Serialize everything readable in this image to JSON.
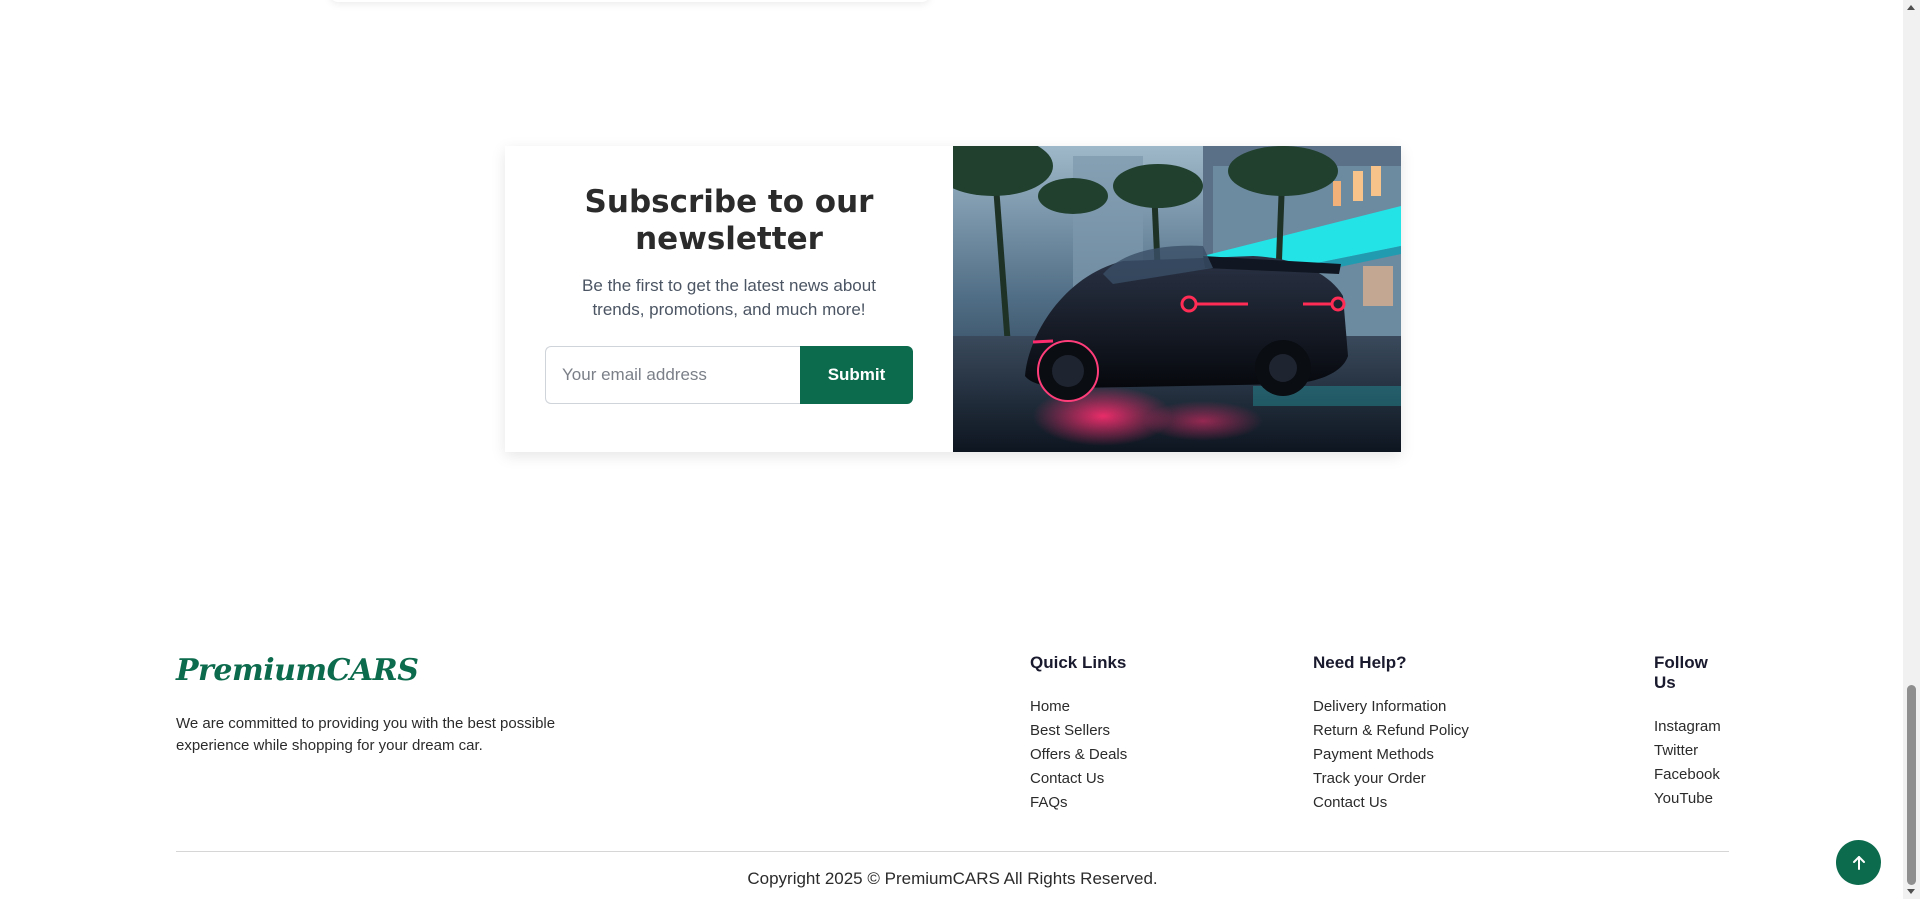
{
  "newsletter": {
    "title": "Subscribe to our newsletter",
    "subtitle": "Be the first to get the latest news about trends, promotions, and much more!",
    "email_placeholder": "Your email address",
    "submit_label": "Submit",
    "image": "sports-car-night-city-image"
  },
  "footer": {
    "brand": "PremiumCARS",
    "description": "We are committed to providing you with the best possible experience while shopping for your dream car.",
    "quick_links": {
      "title": "Quick Links",
      "items": [
        "Home",
        "Best Sellers",
        "Offers & Deals",
        "Contact Us",
        "FAQs"
      ]
    },
    "need_help": {
      "title": "Need Help?",
      "items": [
        "Delivery Information",
        "Return & Refund Policy",
        "Payment Methods",
        "Track your Order",
        "Contact Us"
      ]
    },
    "follow_us": {
      "title": "Follow Us",
      "items": [
        "Instagram",
        "Twitter",
        "Facebook",
        "YouTube"
      ]
    },
    "copyright": "Copyright 2025 © PremiumCARS All Rights Reserved."
  },
  "back_to_top": {
    "icon": "arrow-up-icon"
  },
  "colors": {
    "brand": "#0d6b4d",
    "text": "#2b2b2b",
    "muted": "#4b5563"
  }
}
